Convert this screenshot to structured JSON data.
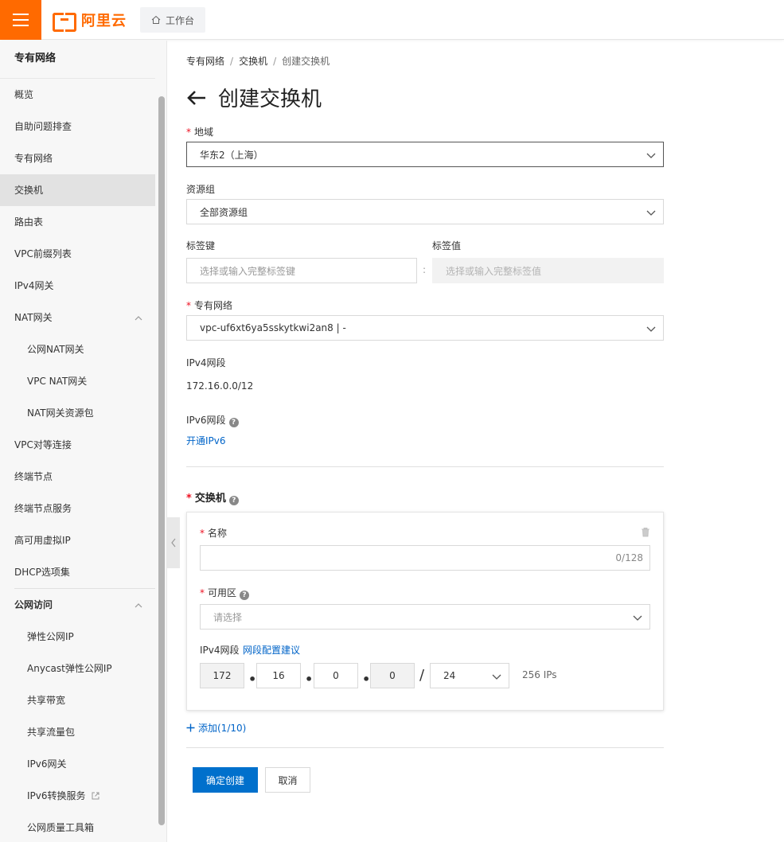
{
  "brand": {
    "logo_text": "阿里云",
    "workbench_label": "工作台",
    "accent": "#ff6a00"
  },
  "sidebar": {
    "title": "专有网络",
    "items": [
      {
        "label": "概览"
      },
      {
        "label": "自助问题排查"
      },
      {
        "label": "专有网络"
      },
      {
        "label": "交换机"
      },
      {
        "label": "路由表"
      },
      {
        "label": "VPC前缀列表"
      },
      {
        "label": "IPv4网关"
      },
      {
        "label": "NAT网关"
      },
      {
        "label": "公网NAT网关"
      },
      {
        "label": "VPC NAT网关"
      },
      {
        "label": "NAT网关资源包"
      },
      {
        "label": "VPC对等连接"
      },
      {
        "label": "终端节点"
      },
      {
        "label": "终端节点服务"
      },
      {
        "label": "高可用虚拟IP"
      },
      {
        "label": "DHCP选项集"
      },
      {
        "label": "公网访问"
      },
      {
        "label": "弹性公网IP"
      },
      {
        "label": "Anycast弹性公网IP"
      },
      {
        "label": "共享带宽"
      },
      {
        "label": "共享流量包"
      },
      {
        "label": "IPv6网关"
      },
      {
        "label": "IPv6转换服务"
      },
      {
        "label": "公网质量工具箱"
      }
    ]
  },
  "breadcrumb": {
    "items": [
      "专有网络",
      "交换机",
      "创建交换机"
    ],
    "separator": "/"
  },
  "page": {
    "title": "创建交换机"
  },
  "form": {
    "required_mark": "*",
    "region": {
      "label": "地域",
      "value": "华东2（上海）"
    },
    "resource_group": {
      "label": "资源组",
      "value": "全部资源组"
    },
    "tag_key": {
      "label": "标签键",
      "placeholder": "选择或输入完整标签键"
    },
    "tag_colon": ":",
    "tag_value": {
      "label": "标签值",
      "placeholder": "选择或输入完整标签值"
    },
    "vpc": {
      "label": "专有网络",
      "value": "vpc-uf6xt6ya5sskytkwi2an8 | -"
    },
    "ipv4_cidr": {
      "label": "IPv4网段",
      "value": "172.16.0.0/12"
    },
    "ipv6_cidr": {
      "label": "IPv6网段",
      "link": "开通IPv6"
    },
    "vswitch": {
      "section_title": "交换机",
      "name": {
        "label": "名称",
        "counter": "0/128"
      },
      "zone": {
        "label": "可用区",
        "placeholder": "请选择"
      },
      "ipv4": {
        "label": "IPv4网段",
        "suggest_link": "网段配置建议",
        "octets": [
          "172",
          "16",
          "0",
          "0"
        ],
        "dot": "•",
        "slash": "/",
        "mask": "24",
        "ip_count": "256 IPs"
      }
    },
    "add_link": "添加(1/10)",
    "submit_label": "确定创建",
    "cancel_label": "取消"
  }
}
